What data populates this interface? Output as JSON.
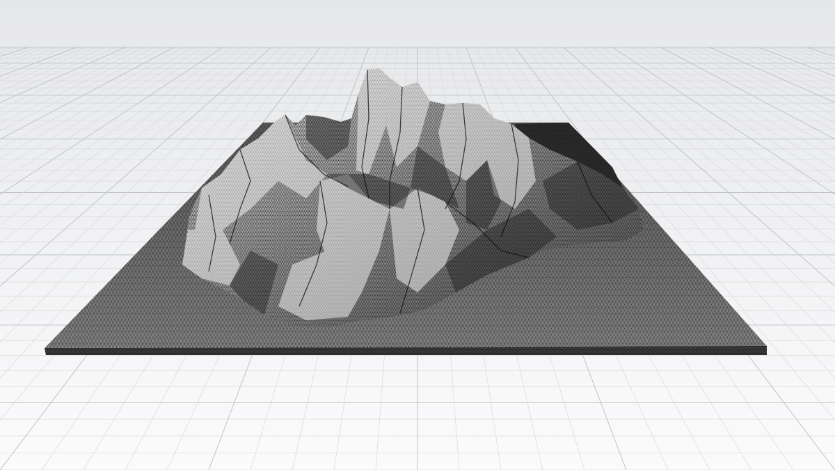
{
  "viewport": {
    "background_top": "#e6e7e9",
    "background_bottom": "#fbfbfc",
    "grid_minor_color": "#d6d9dc",
    "grid_major_color": "#bfc3c7"
  },
  "terrain": {
    "render_mode": "wireframe",
    "wire_color": "#1a1a1a",
    "surface_color": "#7b7b7b",
    "highlight_color": "#f0f0f0",
    "base_side_color": "#3c3c3c"
  }
}
